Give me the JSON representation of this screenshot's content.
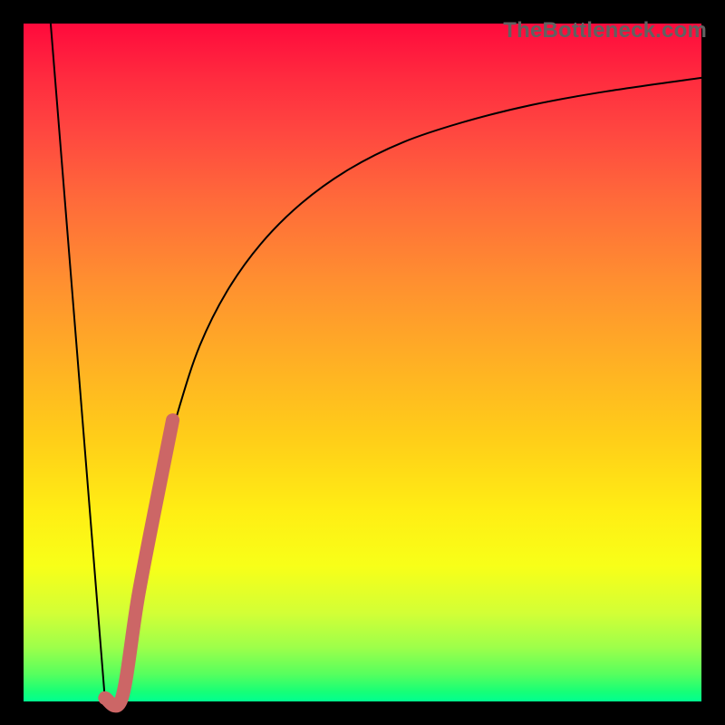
{
  "watermark": "TheBottleneck.com",
  "colors": {
    "frame": "#000000",
    "curve": "#000000",
    "highlight": "#cc6666"
  },
  "chart_data": {
    "type": "line",
    "title": "",
    "xlabel": "",
    "ylabel": "",
    "xlim": [
      0,
      100
    ],
    "ylim": [
      0,
      100
    ],
    "grid": false,
    "legend": false,
    "series": [
      {
        "name": "left-descent",
        "x": [
          4.0,
          12.0
        ],
        "y": [
          100.0,
          0.4
        ]
      },
      {
        "name": "right-curve",
        "x": [
          14.5,
          15.5,
          17.0,
          18.5,
          20.5,
          23.0,
          26.0,
          30.0,
          35.0,
          41.0,
          48.0,
          56.0,
          65.0,
          75.0,
          86.0,
          100.0
        ],
        "y": [
          0.3,
          7.0,
          16.0,
          24.5,
          34.0,
          43.5,
          52.5,
          60.5,
          67.5,
          73.5,
          78.5,
          82.5,
          85.5,
          88.0,
          90.0,
          92.0
        ]
      },
      {
        "name": "highlight-band",
        "x": [
          12.0,
          14.5,
          17.0,
          20.5,
          22.0
        ],
        "y": [
          0.5,
          0.5,
          16.0,
          34.0,
          41.5
        ]
      }
    ]
  }
}
